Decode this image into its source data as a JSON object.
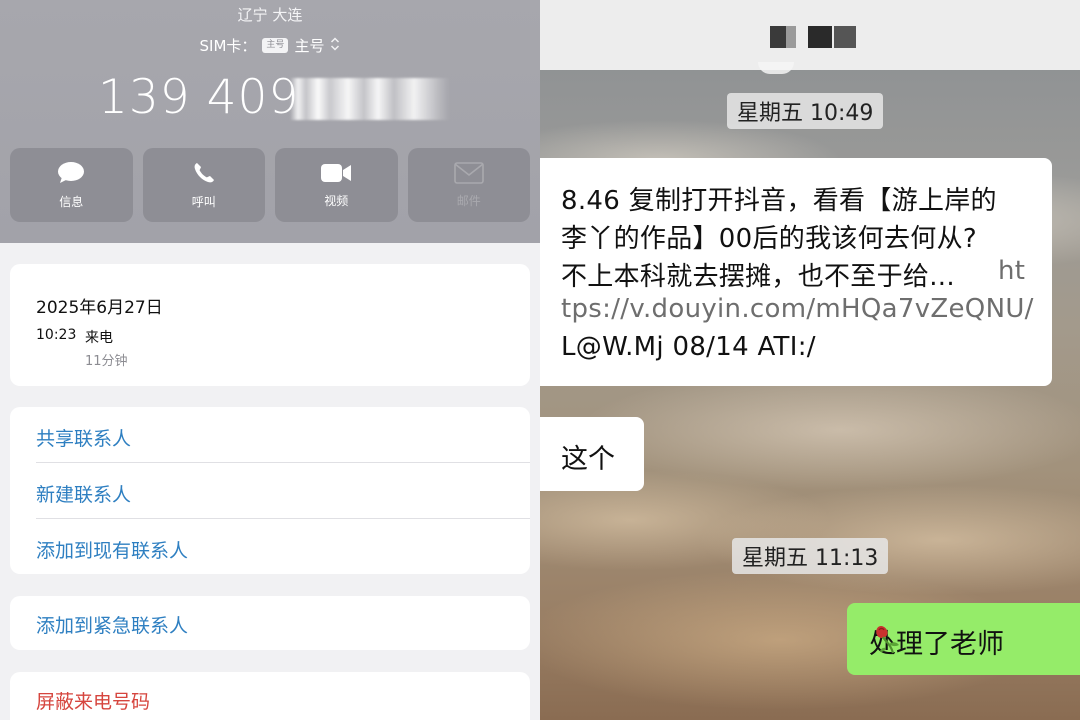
{
  "left": {
    "location": "辽宁 大连",
    "sim": {
      "label": "SIM卡：",
      "badge": "主号",
      "value": "主号"
    },
    "phone_number": "139 409",
    "actions": [
      {
        "label": "信息",
        "icon": "message-icon"
      },
      {
        "label": "呼叫",
        "icon": "phone-icon"
      },
      {
        "label": "视频",
        "icon": "video-icon"
      },
      {
        "label": "邮件",
        "icon": "mail-icon"
      }
    ],
    "call": {
      "date": "2025年6月27日",
      "time": "10:23",
      "type": "来电",
      "duration": "11分钟"
    },
    "contact_actions": [
      "共享联系人",
      "新建联系人",
      "添加到现有联系人"
    ],
    "emergency": "添加到紧急联系人",
    "block": "屏蔽来电号码"
  },
  "right": {
    "timestamps": [
      "星期五 10:49",
      "星期五 11:13"
    ],
    "messages": {
      "m1_lines": [
        "8.46 复制打开抖音，看看【游上岸的",
        "李丫的作品】00后的我该何去何从?",
        "不上本科就去摆摊，也不至于给...",
        "ht",
        "tps://v.douyin.com/mHQa7vZeQNU/",
        "L@W.Mj 08/14 ATI:/"
      ],
      "m2": "这个",
      "m3": "处理了老师"
    },
    "colors": {
      "sent_bubble": "#95ec69",
      "link_blue": "#2e7fc1",
      "block_red": "#d6453e"
    }
  }
}
